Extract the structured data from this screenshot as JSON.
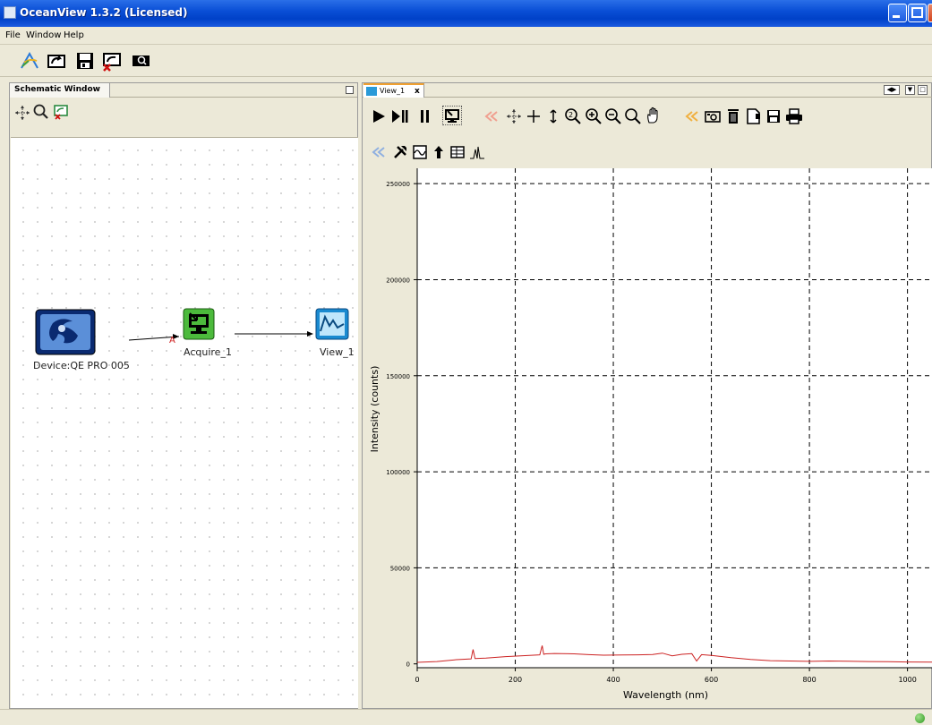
{
  "window": {
    "title": "OceanView 1.3.2 (Licensed)"
  },
  "menu": {
    "items": [
      "File",
      "Window",
      "Help"
    ]
  },
  "toolbar": {
    "icons": [
      "new-project-icon",
      "open-project-icon",
      "save-icon",
      "close-project-icon",
      "device-search-icon"
    ]
  },
  "schematic": {
    "tab_title": "Schematic Window",
    "tools": [
      "move-icon",
      "zoom-icon",
      "delete-node-icon"
    ],
    "nodes": {
      "device": "Device:QE PRO 005",
      "acquire": "Acquire_1",
      "view": "View_1"
    },
    "connector_label": "A"
  },
  "view": {
    "tab_title": "View_1",
    "tab_close": "x"
  },
  "chart_data": {
    "type": "line",
    "xlabel": "Wavelength (nm)",
    "ylabel": "Intensity (counts)",
    "xlim": [
      0,
      1050
    ],
    "ylim": [
      -2000,
      258000
    ],
    "xticks": [
      0,
      200,
      400,
      600,
      800,
      1000
    ],
    "yticks": [
      0,
      50000,
      100000,
      150000,
      200000,
      250000
    ],
    "grid": true,
    "color": "#cc2222",
    "series": [
      {
        "x": [
          0,
          40,
          80,
          110,
          114,
          118,
          140,
          180,
          220,
          250,
          255,
          258,
          262,
          280,
          320,
          350,
          380,
          420,
          450,
          480,
          500,
          520,
          540,
          560,
          570,
          580,
          600,
          640,
          680,
          720,
          760,
          800,
          840,
          880,
          920,
          960,
          1000,
          1050
        ],
        "y": [
          800,
          1200,
          2200,
          2600,
          7500,
          2800,
          3000,
          3800,
          4300,
          4700,
          9500,
          5000,
          5200,
          5400,
          5200,
          4800,
          4500,
          4600,
          4700,
          4900,
          5600,
          4200,
          5000,
          5300,
          1500,
          4800,
          4400,
          3200,
          2300,
          1700,
          1500,
          1300,
          1500,
          1400,
          1200,
          1100,
          1000,
          900
        ]
      }
    ]
  }
}
